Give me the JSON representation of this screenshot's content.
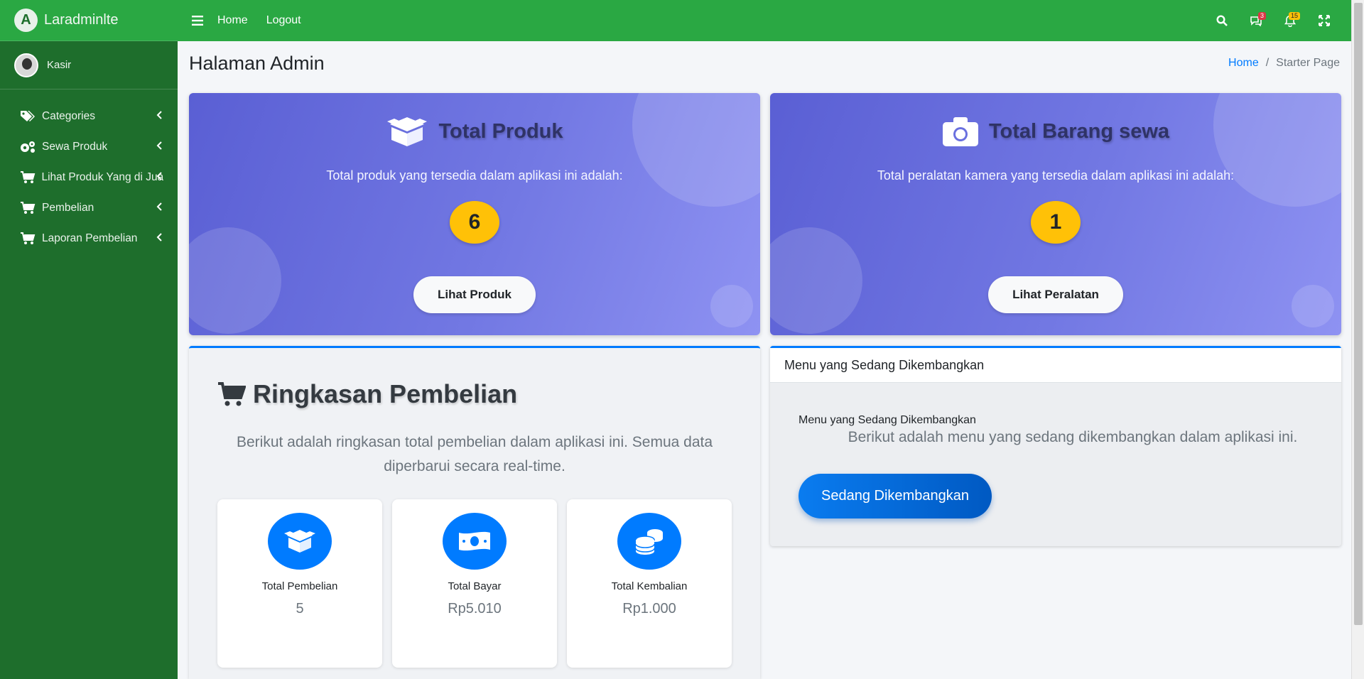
{
  "brand": {
    "name": "Laradminlte",
    "logo_letter": "A"
  },
  "user": {
    "name": "Kasir"
  },
  "sidebar": {
    "items": [
      {
        "label": "Categories",
        "icon": "tags-icon"
      },
      {
        "label": "Sewa Produk",
        "icon": "cogs-icon"
      },
      {
        "label": "Lihat Produk Yang di Jual",
        "icon": "cart-icon"
      },
      {
        "label": "Pembelian",
        "icon": "cart-icon"
      },
      {
        "label": "Laporan Pembelian",
        "icon": "cart-icon"
      }
    ]
  },
  "topbar": {
    "home_label": "Home",
    "logout_label": "Logout",
    "messages_count": "3",
    "notifications_count": "15"
  },
  "page": {
    "title": "Halaman Admin",
    "breadcrumb": {
      "home": "Home",
      "separator": "/",
      "current": "Starter Page"
    }
  },
  "stats": {
    "produk": {
      "title": "Total Produk",
      "description": "Total produk yang tersedia dalam aplikasi ini adalah:",
      "count": "6",
      "button_label": "Lihat Produk"
    },
    "sewa": {
      "title": "Total Barang sewa",
      "description": "Total peralatan kamera yang tersedia dalam aplikasi ini adalah:",
      "count": "1",
      "button_label": "Lihat Peralatan"
    }
  },
  "summary": {
    "title": "Ringkasan Pembelian",
    "description": "Berikut adalah ringkasan total pembelian dalam aplikasi ini. Semua data diperbarui secara real-time.",
    "items": [
      {
        "label": "Total Pembelian",
        "value": "5",
        "icon": "box-icon"
      },
      {
        "label": "Total Bayar",
        "value": "Rp5.010",
        "icon": "money-icon"
      },
      {
        "label": "Total Kembalian",
        "value": "Rp1.000",
        "icon": "coins-icon"
      }
    ]
  },
  "dev": {
    "header": "Menu yang Sedang Dikembangkan",
    "subtitle": "Menu yang Sedang Dikembangkan",
    "description": "Berikut adalah menu yang sedang dikembangkan dalam aplikasi ini.",
    "button_label": "Sedang Dikembangkan"
  },
  "colors": {
    "topbar": "#2aa843",
    "sidebar": "#1e6e2c",
    "accent": "#007bff",
    "count_badge": "#ffc107"
  }
}
